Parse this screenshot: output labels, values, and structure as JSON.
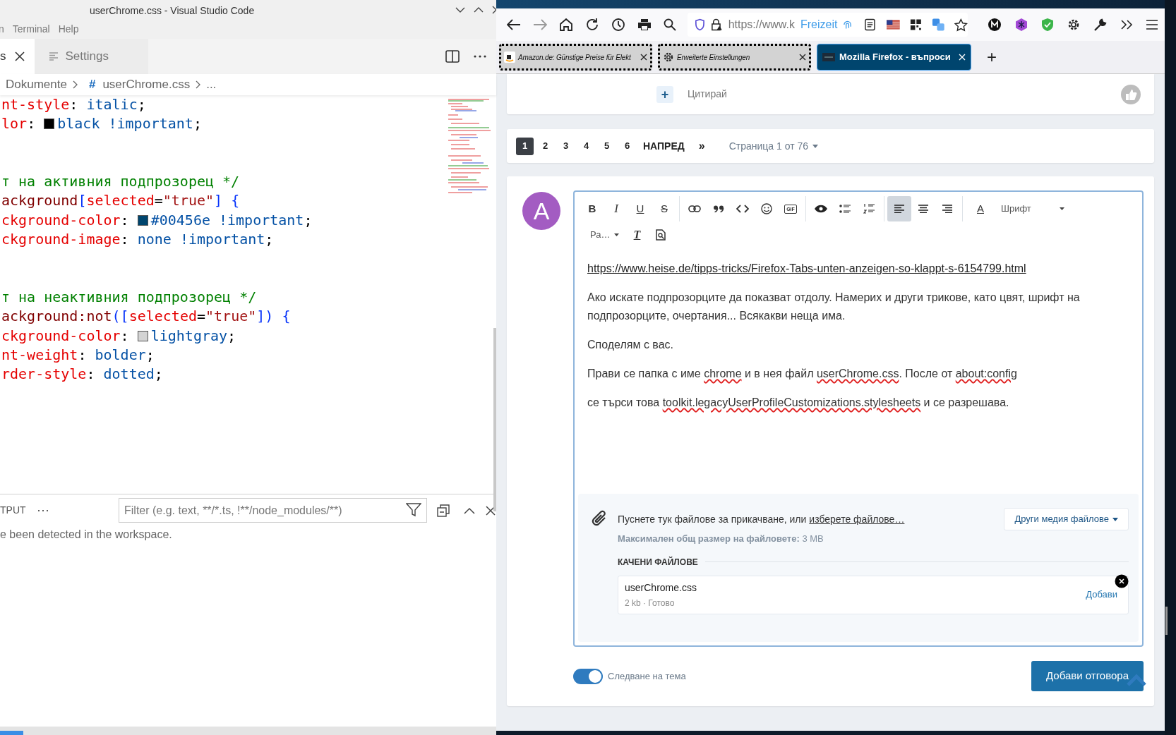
{
  "vscode": {
    "title": "userChrome.css - Visual Studio Code",
    "menu": [
      "n",
      "Terminal",
      "Help"
    ],
    "tabs": [
      {
        "label": "s",
        "selected": true
      },
      {
        "label": "Settings",
        "selected": false
      }
    ],
    "breadcrumb": {
      "folder": "Dokumente",
      "file_mark": "#",
      "file": "userChrome.css",
      "more": "..."
    },
    "code": [
      {
        "kind": "code",
        "tokens": [
          {
            "kind": "prop",
            "text": "nt-style"
          },
          {
            "kind": "punct",
            "text": ": "
          },
          {
            "kind": "value",
            "text": "italic"
          },
          {
            "kind": "punct",
            "text": ";"
          }
        ]
      },
      {
        "kind": "code",
        "tokens": [
          {
            "kind": "prop",
            "text": "lor"
          },
          {
            "kind": "punct",
            "text": ": "
          },
          {
            "kind": "swatch",
            "color": "#000000"
          },
          {
            "kind": "value",
            "text": "black !important"
          },
          {
            "kind": "punct",
            "text": ";"
          }
        ]
      },
      {
        "kind": "blank"
      },
      {
        "kind": "blank"
      },
      {
        "kind": "code",
        "tokens": [
          {
            "kind": "comment",
            "text": "т на активния подпрозорец */"
          }
        ]
      },
      {
        "kind": "code",
        "tokens": [
          {
            "kind": "selector",
            "text": "ackground"
          },
          {
            "kind": "bracket",
            "text": "["
          },
          {
            "kind": "attr",
            "text": "selected"
          },
          {
            "kind": "punct",
            "text": "="
          },
          {
            "kind": "string",
            "text": "\"true\""
          },
          {
            "kind": "bracket",
            "text": "]"
          },
          {
            "kind": "bracket",
            "text": " {"
          }
        ]
      },
      {
        "kind": "code",
        "tokens": [
          {
            "kind": "prop",
            "text": "ckground-color"
          },
          {
            "kind": "punct",
            "text": ": "
          },
          {
            "kind": "swatch",
            "color": "#00456e"
          },
          {
            "kind": "value",
            "text": "#00456e !important"
          },
          {
            "kind": "punct",
            "text": ";"
          }
        ]
      },
      {
        "kind": "code",
        "tokens": [
          {
            "kind": "prop",
            "text": "ckground-image"
          },
          {
            "kind": "punct",
            "text": ": "
          },
          {
            "kind": "value",
            "text": "none !important"
          },
          {
            "kind": "punct",
            "text": ";"
          }
        ]
      },
      {
        "kind": "blank"
      },
      {
        "kind": "blank"
      },
      {
        "kind": "code",
        "tokens": [
          {
            "kind": "comment",
            "text": "т на неактивния подпрозорец */"
          }
        ]
      },
      {
        "kind": "code",
        "tokens": [
          {
            "kind": "selector",
            "text": "ackground:not"
          },
          {
            "kind": "bracket",
            "text": "("
          },
          {
            "kind": "bracket",
            "text": "["
          },
          {
            "kind": "attr",
            "text": "selected"
          },
          {
            "kind": "punct",
            "text": "="
          },
          {
            "kind": "string",
            "text": "\"true\""
          },
          {
            "kind": "bracket",
            "text": "]"
          },
          {
            "kind": "bracket",
            "text": ")"
          },
          {
            "kind": "bracket",
            "text": " {"
          }
        ]
      },
      {
        "kind": "code",
        "tokens": [
          {
            "kind": "prop",
            "text": "ckground-color"
          },
          {
            "kind": "punct",
            "text": ": "
          },
          {
            "kind": "swatch",
            "color": "#d3d3d3"
          },
          {
            "kind": "value",
            "text": "lightgray"
          },
          {
            "kind": "punct",
            "text": ";"
          }
        ]
      },
      {
        "kind": "code",
        "tokens": [
          {
            "kind": "prop",
            "text": "nt-weight"
          },
          {
            "kind": "punct",
            "text": ": "
          },
          {
            "kind": "value",
            "text": "bolder"
          },
          {
            "kind": "punct",
            "text": ";"
          }
        ]
      },
      {
        "kind": "code",
        "tokens": [
          {
            "kind": "prop",
            "text": "rder-style"
          },
          {
            "kind": "punct",
            "text": ": "
          },
          {
            "kind": "value",
            "text": "dotted"
          },
          {
            "kind": "punct",
            "text": ";"
          }
        ]
      }
    ],
    "panel": {
      "tab": "TPUT",
      "more": "···",
      "filter_placeholder": "Filter (e.g. text, **/*.ts, !**/node_modules/**)",
      "message": "e been detected in the workspace."
    }
  },
  "firefox": {
    "url": "https://www.k",
    "url_label": "Freizeit",
    "tabs": [
      {
        "kind": "shop",
        "title": "Amazon.de: Günstige Preise für Elekt",
        "selected": false
      },
      {
        "kind": "settings",
        "title": "Erweiterte Einstellungen",
        "selected": false
      },
      {
        "kind": "forum",
        "title": "Mozilla Firefox - въпроси",
        "selected": true
      }
    ],
    "new_tab": "+",
    "quote": {
      "icon": "+",
      "label": "Цитирай"
    },
    "pages": [
      {
        "label": "1",
        "selected": true
      },
      {
        "label": "2",
        "selected": false
      },
      {
        "label": "3",
        "selected": false
      },
      {
        "label": "4",
        "selected": false
      },
      {
        "label": "5",
        "selected": false
      },
      {
        "label": "6",
        "selected": false
      }
    ],
    "next": "НАПРЕД",
    "last": "»",
    "page_info": "Страница 1 от 76",
    "avatar": {
      "letter": "A",
      "color": "#a35cc2"
    },
    "toolbar": [
      [
        {
          "kind": "bold",
          "label": "B",
          "selected": false
        },
        {
          "kind": "italic",
          "label": "I",
          "selected": false
        },
        {
          "kind": "underline",
          "label": "U",
          "selected": false
        },
        {
          "kind": "strike",
          "label": "S",
          "selected": false
        }
      ],
      [
        {
          "kind": "link",
          "selected": false
        },
        {
          "kind": "quote",
          "selected": false
        },
        {
          "kind": "code",
          "selected": false
        },
        {
          "kind": "smilie",
          "selected": false
        },
        {
          "kind": "gif",
          "label": "GIF",
          "selected": false
        }
      ],
      [
        {
          "kind": "preview",
          "selected": false
        },
        {
          "kind": "bullets",
          "selected": false
        },
        {
          "kind": "numbers",
          "selected": false
        }
      ],
      [
        {
          "kind": "align-left",
          "selected": true
        },
        {
          "kind": "align-center",
          "selected": false
        },
        {
          "kind": "align-right",
          "selected": false
        }
      ],
      [
        {
          "kind": "color",
          "label": "A",
          "selected": false
        },
        {
          "kind": "dropdown",
          "label": "Шрифт",
          "selected": false
        }
      ]
    ],
    "toolbar_row_2": [
      {
        "kind": "dropdown",
        "label": "Ра…",
        "selected": false
      },
      {
        "kind": "clear",
        "label": "T",
        "selected": false
      },
      {
        "kind": "doc-preview",
        "selected": false
      }
    ],
    "paragraphs": [
      {
        "kind": "link",
        "segments": [
          {
            "text": "https://www.heise.de/tipps-tricks/Firefox-Tabs-unten-anzeigen-so-klappt-s-6154799.html",
            "misspelled": false
          }
        ]
      },
      {
        "kind": "text",
        "segments": [
          {
            "text": "Ако искате подпрозорците да показват отдолу. Намерих и други трикове, като цвят, шрифт на подпрозорците, очертания... Всякакви неща има.",
            "misspelled": false
          }
        ]
      },
      {
        "kind": "text",
        "segments": [
          {
            "text": "Споделям с вас.",
            "misspelled": false
          }
        ]
      },
      {
        "kind": "text",
        "segments": [
          {
            "text": "Прави се папка с име ",
            "misspelled": false
          },
          {
            "text": "chrome",
            "misspelled": true
          },
          {
            "text": " и в нея файл ",
            "misspelled": false
          },
          {
            "text": "userChrome.css",
            "misspelled": true
          },
          {
            "text": ". После от ",
            "misspelled": false
          },
          {
            "text": "about:config",
            "misspelled": true
          }
        ]
      },
      {
        "kind": "text",
        "segments": [
          {
            "text": "се търси това ",
            "misspelled": false
          },
          {
            "text": "toolkit.legacyUserProfileCustomizations.stylesheets",
            "misspelled": true
          },
          {
            "text": " и се разрешава.",
            "misspelled": false
          }
        ]
      }
    ],
    "attach": {
      "prompt": "Пуснете тук файлове за прикачване, или",
      "choose": "изберете файлове…",
      "other_media": "Други медия файлове",
      "max_size": "**Максимален общ размер на файловете:** 3 MB",
      "uploaded_heading": "КАЧЕНИ ФАЙЛОВЕ",
      "file": {
        "name": "userChrome.css",
        "meta": "2 kb · Готово",
        "insert": "Добави"
      }
    },
    "watch": {
      "label": "Следване на тема",
      "on": true
    },
    "submit": "Добави отговора"
  }
}
